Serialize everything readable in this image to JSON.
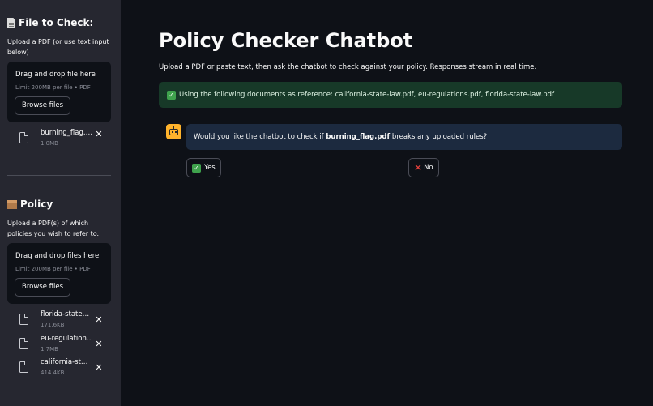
{
  "sidebar": {
    "check_section": {
      "heading": "File to Check:",
      "caption": "Upload a PDF (or use text input below)",
      "dropzone": {
        "title": "Drag and drop file here",
        "limit": "Limit 200MB per file • PDF",
        "browse_label": "Browse files"
      },
      "files": [
        {
          "name": "burning_flag.pdf",
          "size": "1.0MB"
        }
      ]
    },
    "policy_section": {
      "heading": "Policy",
      "caption": "Upload a PDF(s) of which policies you wish to refer to.",
      "dropzone": {
        "title": "Drag and drop files here",
        "limit": "Limit 200MB per file • PDF",
        "browse_label": "Browse files"
      },
      "files": [
        {
          "name": "florida-state-law.pdf",
          "size": "171.6KB"
        },
        {
          "name": "eu-regulations.pdf",
          "size": "1.7MB"
        },
        {
          "name": "california-state-law.pdf",
          "size": "414.4KB"
        }
      ]
    },
    "remove_glyph": "✕"
  },
  "main": {
    "title": "Policy Checker Chatbot",
    "subtitle": "Upload a PDF or paste text, then ask the chatbot to check against your policy. Responses stream in real time.",
    "notice": {
      "icon": "✓",
      "text": "Using the following documents as reference: california-state-law.pdf, eu-regulations.pdf, florida-state-law.pdf"
    },
    "chat": {
      "message_prefix": "Would you like the chatbot to check if ",
      "message_file": "burning_flag.pdf",
      "message_suffix": " breaks any uploaded rules?"
    },
    "buttons": {
      "yes_icon": "✓",
      "yes_label": "Yes",
      "no_icon": "✕",
      "no_label": "No"
    }
  },
  "colors": {
    "app_background": "#0e1117",
    "sidebar_background": "#262730",
    "success_background": "#173928",
    "chat_bubble_background": "#1c2a3f",
    "bot_avatar": "#ffb32c",
    "check_green": "#3fa34d",
    "cross_red": "#e8413c"
  }
}
